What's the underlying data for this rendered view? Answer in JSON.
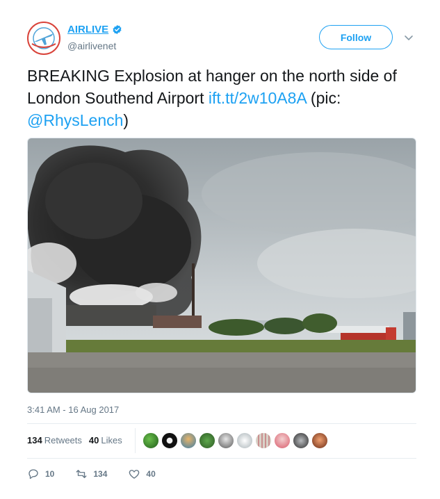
{
  "account": {
    "display_name": "AIRLIVE",
    "handle": "@airlivenet",
    "verified": true,
    "avatar_icon": "airplane-logo-icon"
  },
  "follow_button": {
    "label": "Follow"
  },
  "tweet": {
    "text_line": "BREAKING Explosion at hanger on the north side of London Southend Airport",
    "link": "ift.tt/2w10A8A",
    "pic_prefix": "(pic: ",
    "mention": "@RhysLench",
    "pic_suffix": ")"
  },
  "timestamp": "3:41 AM - 16 Aug 2017",
  "stats": {
    "retweets_count": "134",
    "retweets_label": "Retweets",
    "likes_count": "40",
    "likes_label": "Likes"
  },
  "actions": {
    "reply_count": "10",
    "retweet_count": "134",
    "like_count": "40"
  },
  "colors": {
    "accent": "#1da1f2",
    "muted": "#657786",
    "text": "#14171a",
    "divider": "#e6ecf0"
  }
}
